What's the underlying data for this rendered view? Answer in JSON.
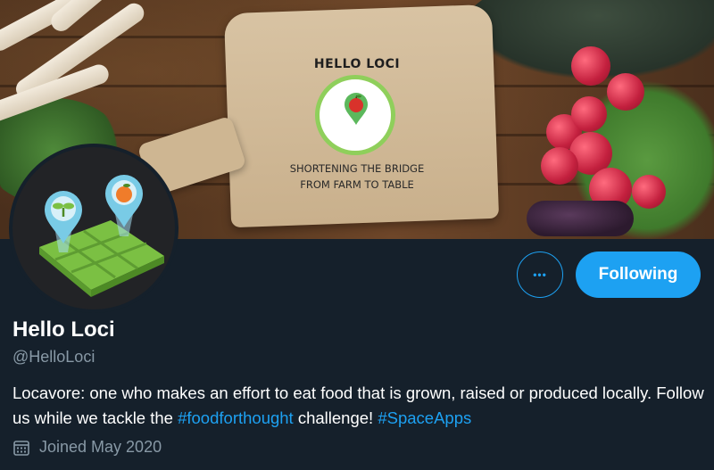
{
  "banner": {
    "title": "HELLO LOCI",
    "subtitle_line1": "SHORTENING THE BRIDGE",
    "subtitle_line2": "FROM FARM TO TABLE"
  },
  "actions": {
    "more_icon": "more-horizontal-icon",
    "more_label": "•••",
    "follow_label": "Following"
  },
  "profile": {
    "name": "Hello Loci",
    "handle": "@HelloLoci",
    "bio_text_1": "Locavore: one who makes an effort to eat food that is grown, raised or produced locally. Follow us while we tackle the ",
    "bio_link_1": "#foodforthought",
    "bio_text_2": " challenge! ",
    "bio_link_2": "#SpaceApps",
    "joined_icon": "calendar-icon",
    "joined": "Joined May 2020"
  },
  "colors": {
    "background": "#15202b",
    "accent": "#1da1f2",
    "secondary_text": "#8899a6"
  }
}
